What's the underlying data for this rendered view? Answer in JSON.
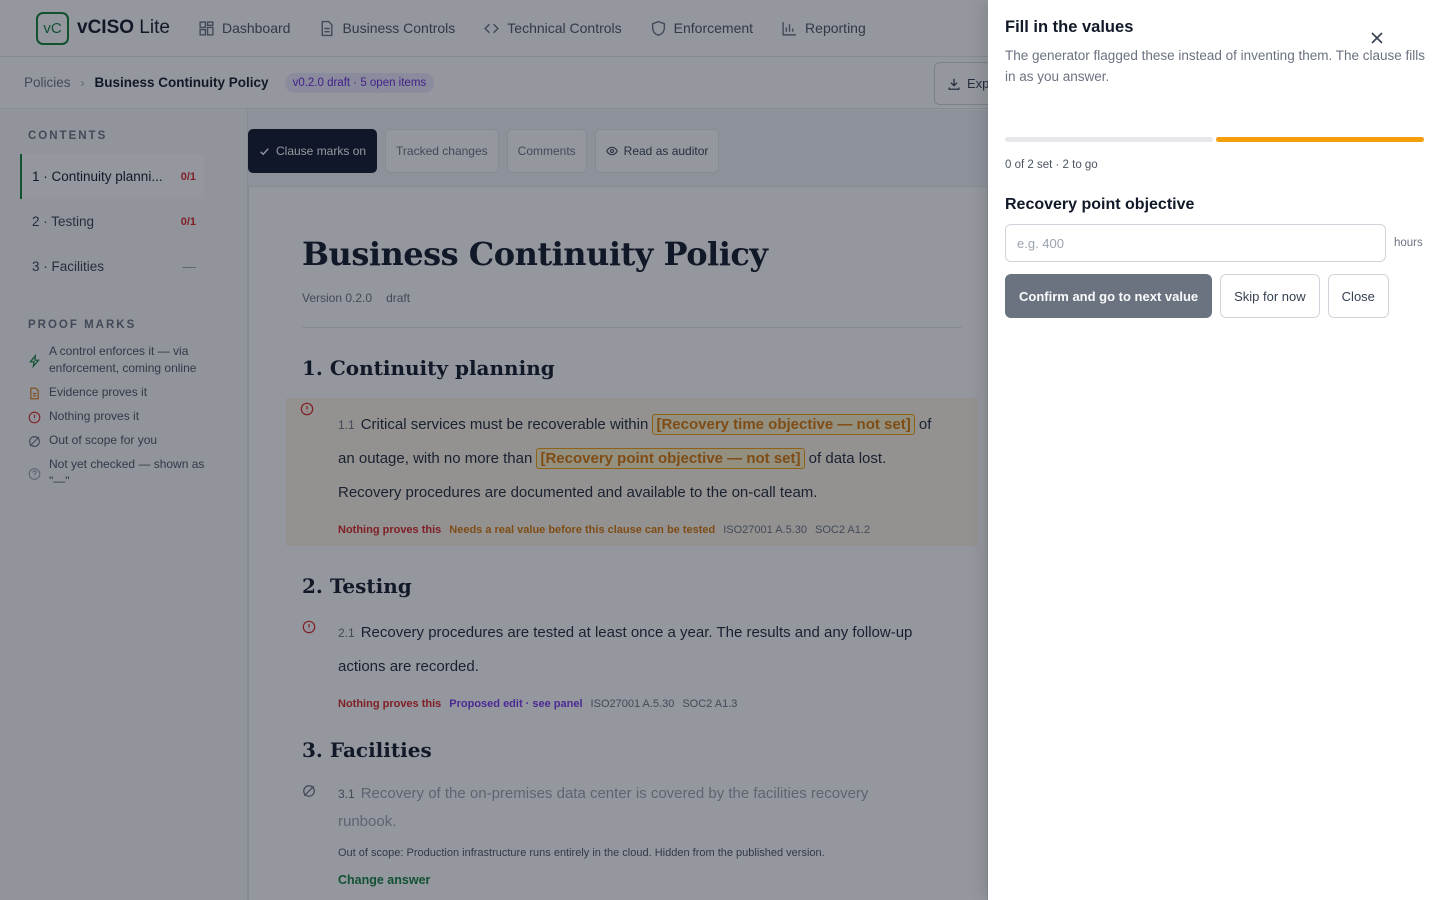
{
  "app": {
    "logo_mark": "vC",
    "logo_name": "vCISO",
    "logo_suffix": " Lite",
    "nav": [
      "Dashboard",
      "Business Controls",
      "Technical Controls",
      "Enforcement",
      "Reporting"
    ]
  },
  "breadcrumb": {
    "parent": "Policies",
    "current": "Business Continuity Policy",
    "badge": "v0.2.0 draft · 5 open items"
  },
  "export_label": "Exp",
  "sidebar": {
    "contents_heading": "CONTENTS",
    "toc": [
      {
        "label": "1 · Continuity planni...",
        "count": "0/1"
      },
      {
        "label": "2 · Testing",
        "count": "0/1"
      },
      {
        "label": "3 · Facilities",
        "count": "—"
      }
    ],
    "proof_heading": "PROOF MARKS",
    "legend": [
      "A control enforces it — via enforcement, coming online",
      "Evidence proves it",
      "Nothing proves it",
      "Out of scope for you",
      "Not yet checked — shown as \"—\""
    ]
  },
  "toolbar": {
    "clause_marks": "Clause marks on",
    "tracked": "Tracked changes",
    "comments": "Comments",
    "auditor": "Read as auditor"
  },
  "document": {
    "title": "Business Continuity Policy",
    "version": "Version 0.2.0",
    "status": "draft",
    "sections": {
      "s1": "1. Continuity planning",
      "s2": "2. Testing",
      "s3": "3. Facilities"
    },
    "c11": {
      "num": "1.1",
      "t1": "Critical services must be recoverable within ",
      "chip1": "[Recovery time objective — not set]",
      "t2": " of an outage, with no more than ",
      "chip2": "[Recovery point objective — not set]",
      "t3": " of data lost.",
      "t4": "Recovery procedures are documented and available to the on-call team.",
      "tags": [
        "Nothing proves this",
        "Needs a real value before this clause can be tested",
        "ISO27001 A.5.30",
        "SOC2 A1.2"
      ]
    },
    "c21": {
      "num": "2.1",
      "text": "Recovery procedures are tested at least once a year. The results and any follow-up actions are recorded.",
      "tags": [
        "Nothing proves this",
        "Proposed edit · see panel",
        "ISO27001 A.5.30",
        "SOC2 A1.3"
      ]
    },
    "c31": {
      "num": "3.1",
      "text": "Recovery of the on-premises data center is covered by the facilities recovery runbook.",
      "note": "Out of scope: Production infrastructure runs entirely in the cloud. Hidden from the published version.",
      "link": "Change answer"
    }
  },
  "drawer": {
    "title": "Fill in the values",
    "subtitle": "The generator flagged these instead of inventing them. The clause fills in as you answer.",
    "progress_text": "0 of 2 set · 2 to go",
    "progress": {
      "total": 2,
      "set": 0,
      "current_index": 2
    },
    "field_label": "Recovery point objective",
    "field_value": "",
    "field_placeholder": "e.g. 400",
    "field_unit": "hours",
    "confirm": "Confirm and go to next value",
    "skip": "Skip for now",
    "close": "Close"
  },
  "colors": {
    "brand": "#15803d",
    "warning": "#f59e0b",
    "danger": "#dc2626",
    "purple": "#7c3aed"
  }
}
